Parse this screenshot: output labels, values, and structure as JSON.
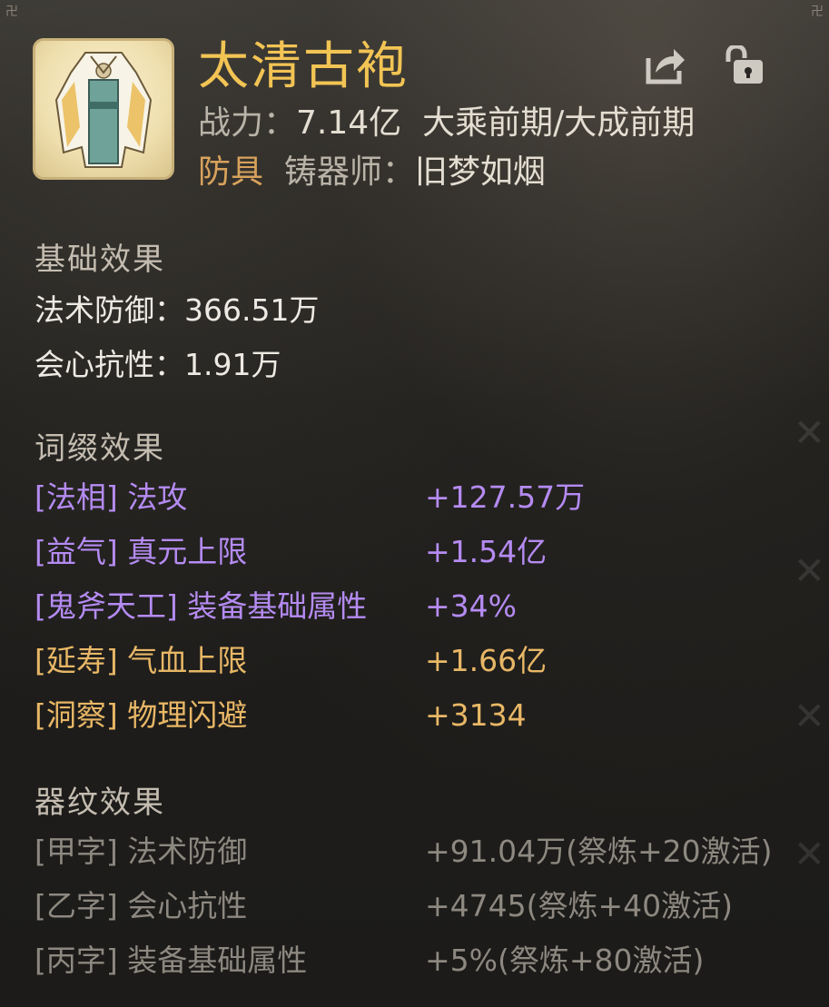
{
  "item": {
    "name": "太清古袍",
    "power_label": "战力：",
    "power_value": "7.14亿",
    "realm": "大乘前期/大成前期",
    "type": "防具",
    "smith_label": "铸器师：",
    "smith_name": "旧梦如烟",
    "icon": "robe-icon"
  },
  "toolbar": {
    "share_icon": "share-icon",
    "lock_icon": "lock-icon"
  },
  "sections": {
    "base": {
      "title": "基础效果",
      "rows": [
        {
          "label": "法术防御：",
          "value": "366.51万"
        },
        {
          "label": "会心抗性：",
          "value": "1.91万"
        }
      ]
    },
    "affix": {
      "title": "词缀效果",
      "rows": [
        {
          "name": "[法相] 法攻",
          "value": "+127.57万",
          "color": "#b58bf2"
        },
        {
          "name": "[益气] 真元上限",
          "value": "+1.54亿",
          "color": "#b58bf2"
        },
        {
          "name": "[鬼斧天工] 装备基础属性",
          "value": "+34%",
          "color": "#b58bf2"
        },
        {
          "name": "[延寿] 气血上限",
          "value": "+1.66亿",
          "color": "#e8b766"
        },
        {
          "name": "[洞察] 物理闪避",
          "value": "+3134",
          "color": "#e8b766"
        }
      ]
    },
    "pattern": {
      "title": "器纹效果",
      "rows": [
        {
          "name": "[甲字] 法术防御",
          "value": "+91.04万(祭炼+20激活)"
        },
        {
          "name": "[乙字] 会心抗性",
          "value": "+4745(祭炼+40激活)"
        },
        {
          "name": "[丙字] 装备基础属性",
          "value": "+5%(祭炼+80激活)"
        }
      ]
    }
  },
  "colors": {
    "title": "#f2c454",
    "affix_purple": "#b58bf2",
    "affix_orange": "#e8b766",
    "inactive_gray": "#8d8880"
  }
}
